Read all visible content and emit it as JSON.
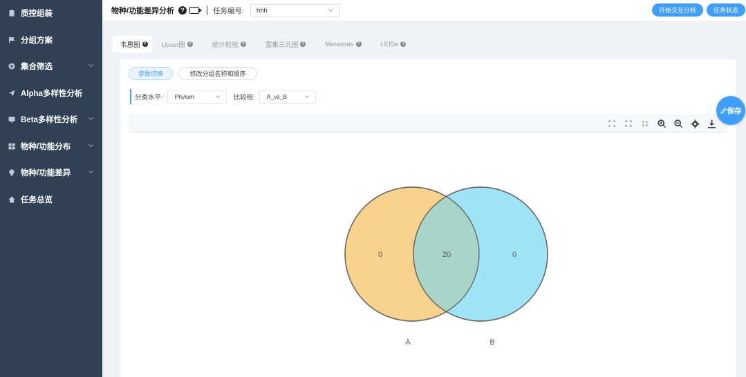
{
  "sidebar": {
    "items": [
      {
        "label": "质控组装",
        "icon": "clipboard-icon",
        "has_chevron": false
      },
      {
        "label": "分组方案",
        "icon": "flag-icon",
        "has_chevron": false
      },
      {
        "label": "集合筛选",
        "icon": "circle-plus-icon",
        "has_chevron": true
      },
      {
        "label": "Alpha多样性分析",
        "icon": "send-icon",
        "has_chevron": false
      },
      {
        "label": "Beta多样性分析",
        "icon": "monitor-icon",
        "has_chevron": true
      },
      {
        "label": "物种/功能分布",
        "icon": "grid-icon",
        "has_chevron": true
      },
      {
        "label": "物种/功能差异",
        "icon": "bulb-icon",
        "has_chevron": true
      },
      {
        "label": "任务总览",
        "icon": "home-icon",
        "has_chevron": false
      }
    ]
  },
  "header": {
    "title": "物种/功能差异分析",
    "task_label": "任务编号:",
    "task_value": "hhh",
    "btn_interactive": "开始交互分析",
    "btn_status": "任务状态"
  },
  "tabs": [
    {
      "label": "韦恩图",
      "active": true
    },
    {
      "label": "Upset图",
      "active": false
    },
    {
      "label": "统计检验",
      "active": false
    },
    {
      "label": "富集三元图",
      "active": false
    },
    {
      "label": "Metastats",
      "active": false
    },
    {
      "label": "LEfSe",
      "active": false
    }
  ],
  "panel": {
    "pill_params": "参数切换",
    "pill_rename": "修改分组名称和顺序",
    "level_label": "分类水平:",
    "level_value": "Phylum",
    "compare_label": "比较组:",
    "compare_value": "A_vs_B"
  },
  "save_label": "保存",
  "colors": {
    "accent": "#409eff",
    "sidebar": "#304156",
    "set_a": "#f7d28c",
    "set_b": "#9fe4f6",
    "overlap": "#a8d5c8"
  },
  "chart_data": {
    "type": "venn",
    "sets": [
      {
        "name": "A",
        "only": 0
      },
      {
        "name": "B",
        "only": 0
      }
    ],
    "intersection": 20
  }
}
